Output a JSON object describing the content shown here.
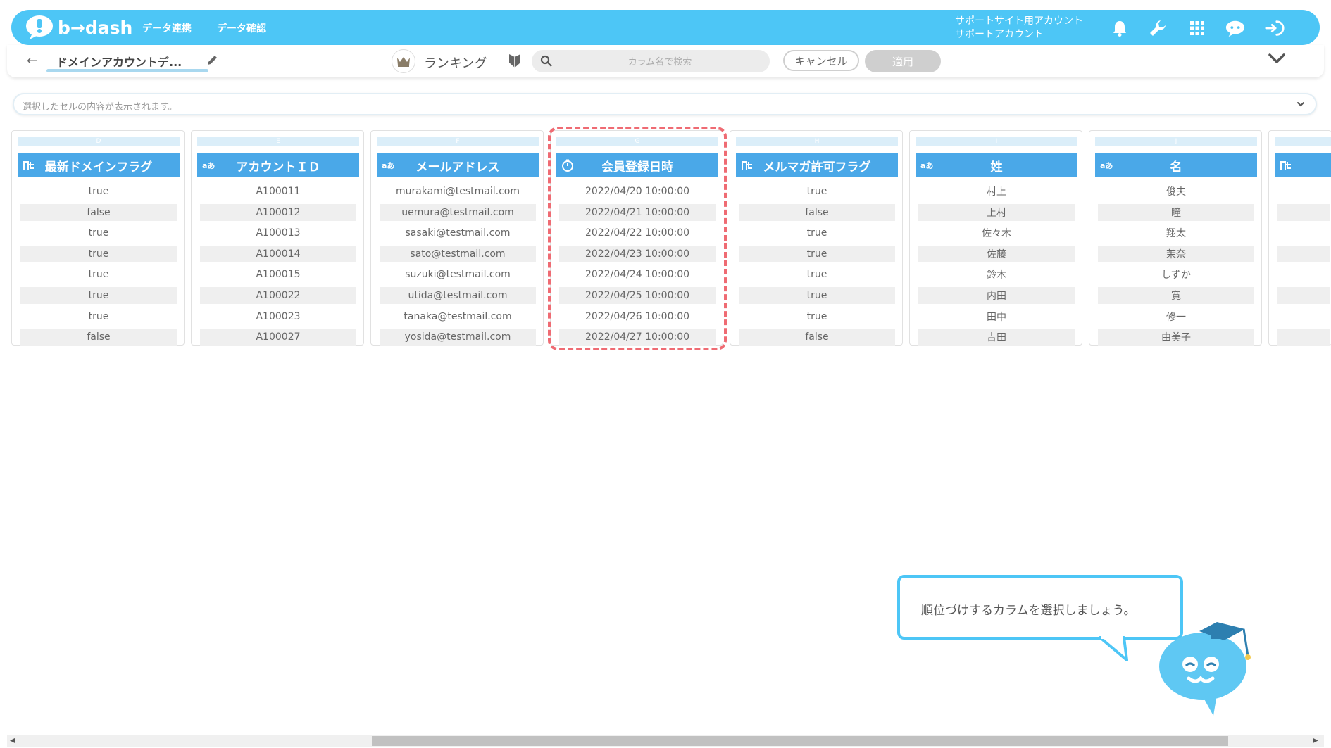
{
  "header": {
    "logo_text": "b→dash",
    "nav": [
      "データ連携",
      "データ確認"
    ],
    "account_line1": "サポートサイト用アカウント",
    "account_line2": "サポートアカウント",
    "icons": [
      "bell-icon",
      "wrench-icon",
      "grid-icon",
      "chat-icon",
      "logout-icon"
    ],
    "color": "#4dc6f6"
  },
  "toolbar": {
    "back_icon": "←",
    "title": "ドメインアカウントデ...",
    "ranking_label": "ランキング",
    "search_placeholder": "カラム名で検索",
    "cancel_label": "キャンセル",
    "apply_label": "適用"
  },
  "cellbar": {
    "placeholder": "選択したセルの内容が表示されます。"
  },
  "columns": [
    {
      "letter": "D",
      "name": "最新ドメインフラグ",
      "type": "flag",
      "cells": [
        "true",
        "false",
        "true",
        "true",
        "true",
        "true",
        "true",
        "false"
      ]
    },
    {
      "letter": "E",
      "name": "アカウントＩＤ",
      "type": "text",
      "cells": [
        "A100011",
        "A100012",
        "A100013",
        "A100014",
        "A100015",
        "A100022",
        "A100023",
        "A100027"
      ]
    },
    {
      "letter": "F",
      "name": "メールアドレス",
      "type": "text",
      "cells": [
        "murakami@testmail.com",
        "uemura@testmail.com",
        "sasaki@testmail.com",
        "sato@testmail.com",
        "suzuki@testmail.com",
        "utida@testmail.com",
        "tanaka@testmail.com",
        "yosida@testmail.com"
      ]
    },
    {
      "letter": "G",
      "name": "会員登録日時",
      "type": "datetime",
      "cells": [
        "2022/04/20 10:00:00",
        "2022/04/21 10:00:00",
        "2022/04/22 10:00:00",
        "2022/04/23 10:00:00",
        "2022/04/24 10:00:00",
        "2022/04/25 10:00:00",
        "2022/04/26 10:00:00",
        "2022/04/27 10:00:00"
      ]
    },
    {
      "letter": "H",
      "name": "メルマガ許可フラグ",
      "type": "flag",
      "cells": [
        "true",
        "false",
        "true",
        "true",
        "true",
        "true",
        "true",
        "false"
      ]
    },
    {
      "letter": "I",
      "name": "姓",
      "type": "text",
      "cells": [
        "村上",
        "上村",
        "佐々木",
        "佐藤",
        "鈴木",
        "内田",
        "田中",
        "吉田"
      ]
    },
    {
      "letter": "J",
      "name": "名",
      "type": "text",
      "cells": [
        "俊夫",
        "瞳",
        "翔太",
        "茉奈",
        "しずか",
        "寛",
        "修一",
        "由美子"
      ]
    },
    {
      "letter": "",
      "name": "",
      "type": "flag",
      "cells": [
        "",
        "",
        "",
        "",
        "",
        "",
        "",
        ""
      ]
    }
  ],
  "type_icon_text": "aあ",
  "highlight_color": "#ef6b73",
  "tooltip": {
    "text": "順位づけするカラムを選択しましょう。"
  }
}
